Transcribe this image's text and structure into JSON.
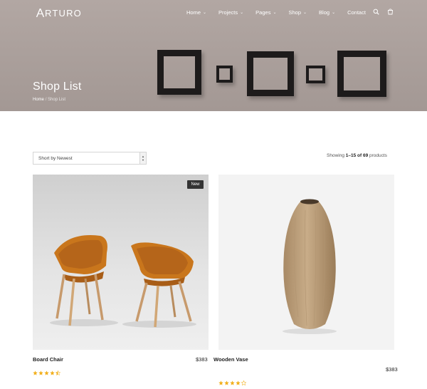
{
  "brand": {
    "logo_text": "RTURO",
    "logo_alt": "Arturo"
  },
  "nav": {
    "items": [
      {
        "label": "Home",
        "has_dropdown": true
      },
      {
        "label": "Projects",
        "has_dropdown": true
      },
      {
        "label": "Pages",
        "has_dropdown": true
      },
      {
        "label": "Shop",
        "has_dropdown": true
      },
      {
        "label": "Blog",
        "has_dropdown": true
      },
      {
        "label": "Contact",
        "has_dropdown": false
      }
    ],
    "icons": [
      "search-icon",
      "cart-icon"
    ]
  },
  "hero": {
    "title": "Shop List",
    "breadcrumb": {
      "home": "Home",
      "separator": "/",
      "current": "Shop List"
    }
  },
  "toolbar": {
    "sort_value": "Short by Newest",
    "count_prefix": "Showing ",
    "count_range": "1–15 of 69",
    "count_suffix": " products"
  },
  "products": [
    {
      "name": "Board Chair",
      "price": "$383",
      "rating": 4.5,
      "badge": "New"
    },
    {
      "name": "Wooden Vase",
      "price": "$383",
      "rating": 4
    }
  ],
  "colors": {
    "star": "#f2b01e",
    "hero_bg": "#aba09c",
    "frame": "#1d1b1b",
    "badge_bg": "#333333"
  }
}
